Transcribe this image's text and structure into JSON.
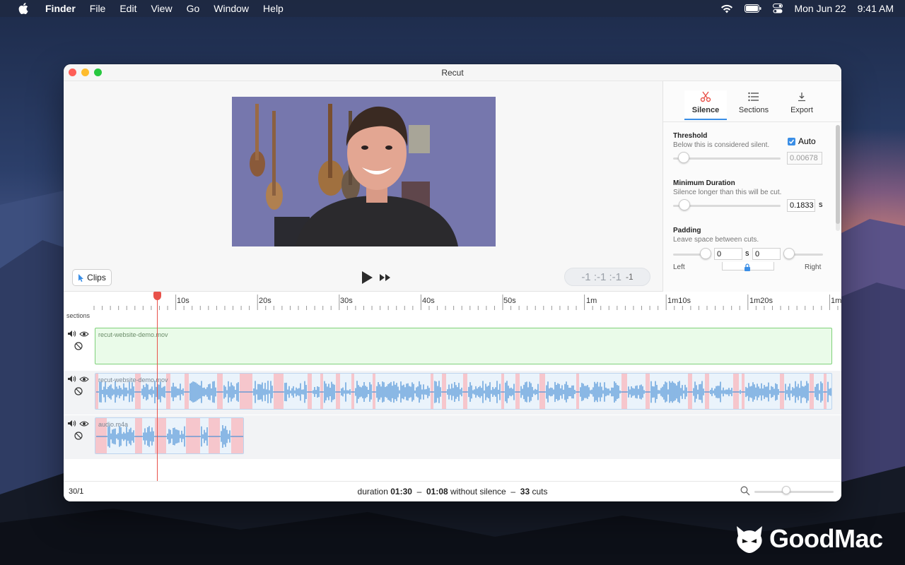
{
  "menubar": {
    "app_name": "Finder",
    "items": [
      "File",
      "Edit",
      "View",
      "Go",
      "Window",
      "Help"
    ],
    "date": "Mon Jun 22",
    "time": "9:41 AM"
  },
  "window": {
    "title": "Recut"
  },
  "controls": {
    "clips_label": "Clips",
    "timecode": "-1 :-1 :-1",
    "timecode_frames": "-1"
  },
  "side_panel": {
    "tabs": [
      {
        "label": "Silence",
        "icon": "scissors-icon",
        "active": true
      },
      {
        "label": "Sections",
        "icon": "list-icon",
        "active": false
      },
      {
        "label": "Export",
        "icon": "download-icon",
        "active": false
      }
    ],
    "threshold": {
      "heading": "Threshold",
      "description": "Below this is considered silent.",
      "auto_label": "Auto",
      "auto_checked": true,
      "value": "0.00678",
      "slider_level": 0.1
    },
    "min_duration": {
      "heading": "Minimum Duration",
      "description": "Silence longer than this will be cut.",
      "value": "0.1833",
      "unit": "s",
      "slider_level": 0.05
    },
    "padding": {
      "heading": "Padding",
      "description": "Leave space between cuts.",
      "left_value": "0",
      "right_value": "0",
      "unit": "s",
      "left_label": "Left",
      "right_label": "Right"
    }
  },
  "timeline": {
    "ruler_labels": [
      "10s",
      "20s",
      "30s",
      "40s",
      "50s",
      "1m",
      "1m10s",
      "1m20s",
      "1m"
    ],
    "sections_label": "sections",
    "tracks": [
      {
        "clip_name": "recut-website-demo.mov",
        "kind": "video"
      },
      {
        "clip_name": "recut-website-demo.mov",
        "kind": "audio"
      },
      {
        "clip_name": "audio.m4a",
        "kind": "audio"
      }
    ]
  },
  "status": {
    "fps": "30/1",
    "duration_label": "duration",
    "duration_value": "01:30",
    "sep1": "–",
    "trimmed_value": "01:08",
    "trimmed_label": "without silence",
    "sep2": "–",
    "cuts_value": "33",
    "cuts_label": "cuts",
    "zoom_level": 0.4
  },
  "watermark": {
    "brand": "GoodMac"
  },
  "colors": {
    "accent": "#3a8ee6",
    "playhead": "#e8524a",
    "waveform": "#4a90d6",
    "cut_region": "#f6c6cc"
  }
}
